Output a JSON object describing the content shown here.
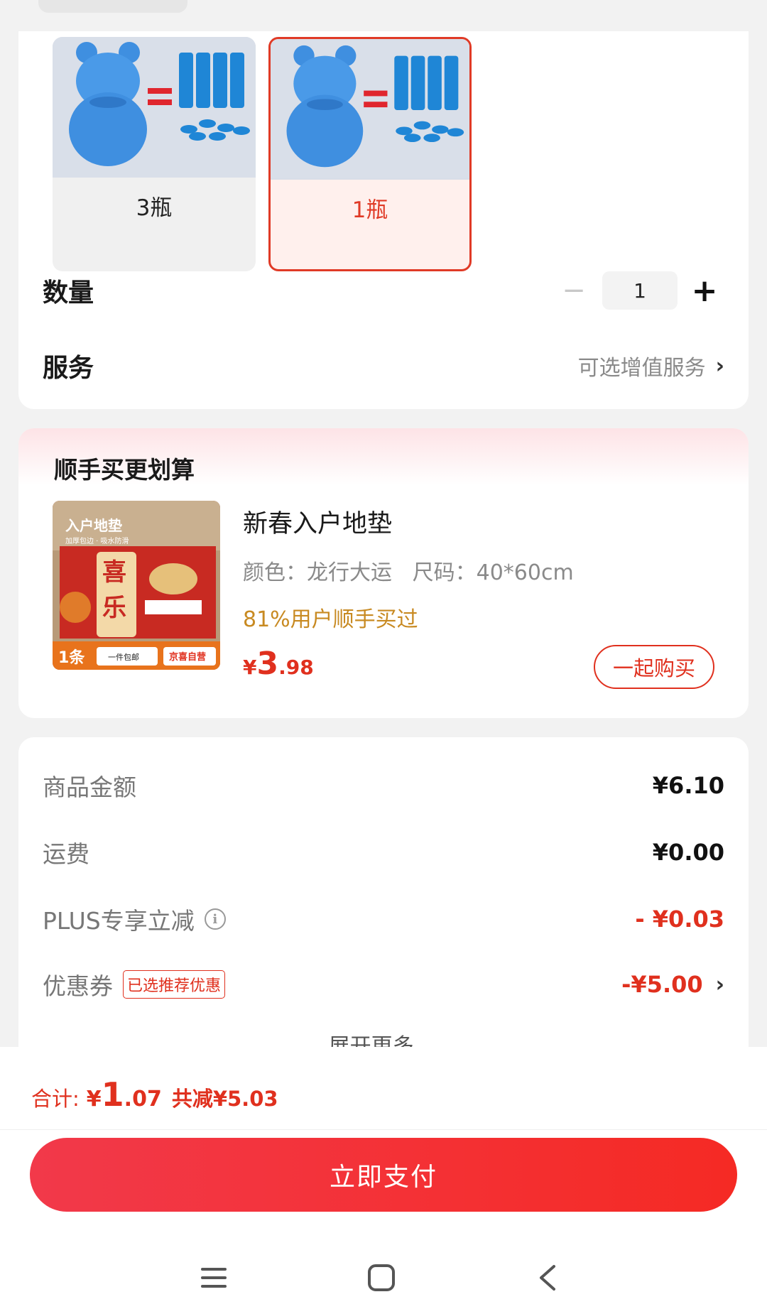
{
  "spec": {
    "variants": [
      {
        "label": "3瓶",
        "selected": false
      },
      {
        "label": "1瓶",
        "selected": true
      }
    ],
    "quantity": {
      "label": "数量",
      "value": "1",
      "minus": "−",
      "plus": "+"
    },
    "service": {
      "label": "服务",
      "value": "可选增值服务",
      "chevron": "›"
    }
  },
  "upsell": {
    "title": "顺手买更划算",
    "product": {
      "name": "新春入户地垫",
      "spec": "颜色：龙行大运   尺码：40*60cm",
      "bought": "81%用户顺手买过",
      "price": {
        "currency": "¥",
        "integer": "3",
        "decimal": ".98"
      },
      "button": "一起购买",
      "image_text": {
        "top": "入户地垫",
        "sub": "加厚包边 · 吸水防滑",
        "c1": "喜",
        "c2": "乐",
        "tag": "1条",
        "free": "一件包邮",
        "store": "京喜自营"
      }
    }
  },
  "summary": {
    "rows": [
      {
        "label": "商品金额",
        "value": "¥6.10",
        "highlight": false
      },
      {
        "label": "运费",
        "value": "¥0.00",
        "highlight": false
      },
      {
        "label": "PLUS专享立减",
        "value": "- ¥0.03",
        "highlight": true,
        "info_icon": "i"
      },
      {
        "label": "优惠券",
        "value": "-¥5.00",
        "highlight": true,
        "badge": "已选推荐优惠",
        "chevron": "›"
      }
    ],
    "expand": "展开更多 ⌄"
  },
  "footer": {
    "total_label": "合计:",
    "total": {
      "currency": "¥",
      "integer": "1",
      "decimal": ".07"
    },
    "saved": "共减¥5.03",
    "pay_button": "立即支付"
  },
  "colors": {
    "accent": "#e0301e",
    "gold": "#c88a22",
    "pay_start": "#f2394a",
    "pay_end": "#f52a24"
  },
  "icons": {
    "nav": [
      "menu-icon",
      "home-icon",
      "back-icon"
    ]
  }
}
